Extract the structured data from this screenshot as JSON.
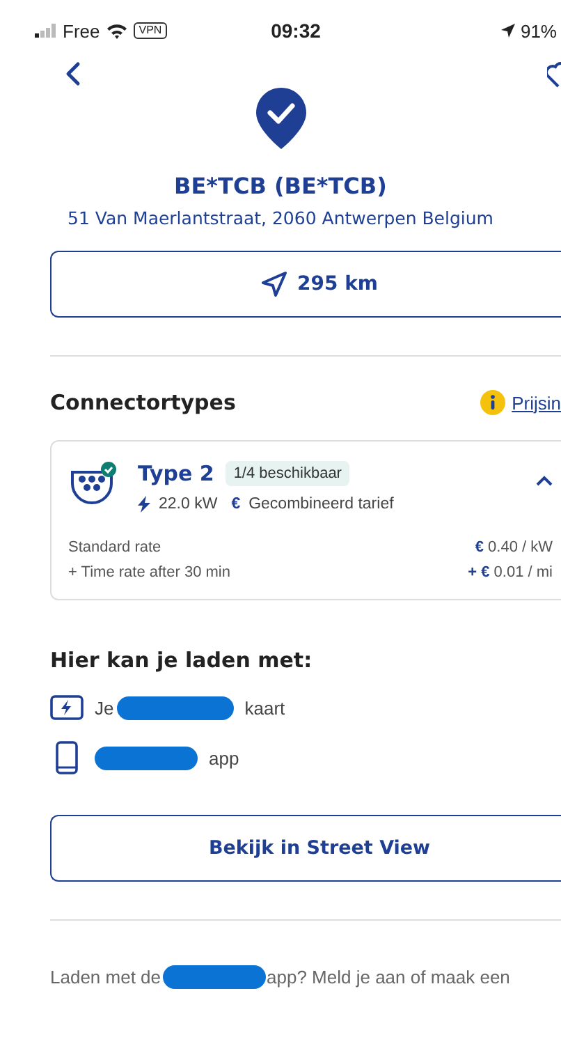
{
  "status_bar": {
    "carrier": "Free",
    "vpn": "VPN",
    "time": "09:32",
    "battery": "91%"
  },
  "station": {
    "name": "BE*TCB (BE*TCB)",
    "address": "51 Van Maerlantstraat, 2060 Antwerpen Belgium",
    "distance": "295 km"
  },
  "connectors": {
    "title": "Connectortypes",
    "price_link": "Prijsin",
    "items": [
      {
        "name": "Type 2",
        "availability": "1/4 beschikbaar",
        "power": "22.0 kW",
        "currency": "€",
        "tariff": "Gecombineerd tarief",
        "expanded": true,
        "rates": [
          {
            "label": "Standard rate",
            "price": "**€** 0.40 / kW"
          },
          {
            "label": "+ Time rate after 30 min",
            "price": "**+ €** 0.01 / mi"
          }
        ]
      }
    ]
  },
  "charge_with": {
    "title": "Hier kan je laden met:",
    "methods": [
      {
        "kind": "card",
        "before": "Je",
        "after": "kaart"
      },
      {
        "kind": "app",
        "after": "app"
      }
    ]
  },
  "street_view_button": "Bekijk in Street View",
  "footer": {
    "before": "Laden met de",
    "after": "app? Meld je aan of maak een"
  }
}
